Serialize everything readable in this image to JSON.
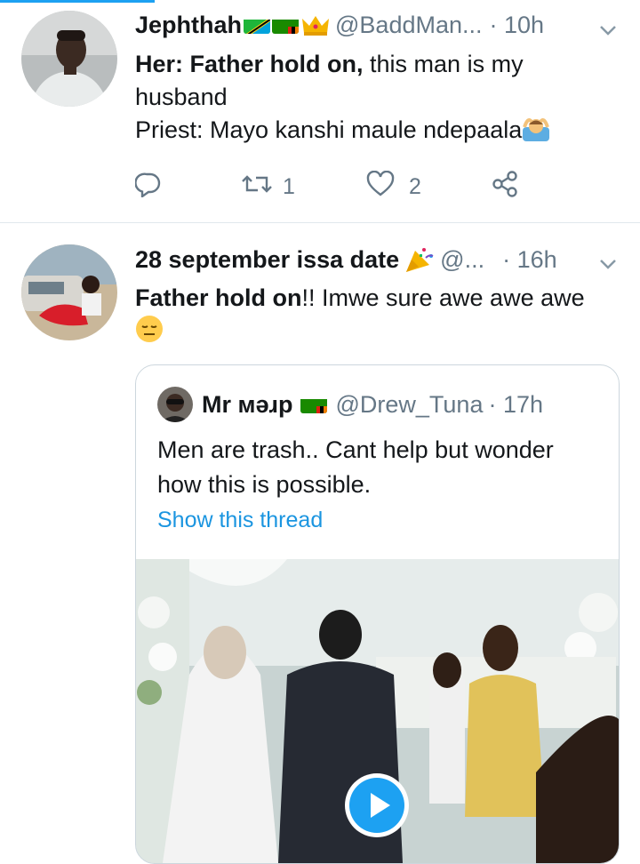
{
  "tweets": [
    {
      "name": "Jephthah",
      "handle": "@BaddMan...",
      "time": "· 10h",
      "line1_bold_label": "Her:",
      "line1_bold": "Father hold on,",
      "line1_rest": " this man is my husband",
      "line2": "Priest: Mayo kanshi maule ndepaala",
      "replies": "",
      "retweets": "1",
      "likes": "2"
    },
    {
      "name": "28 september issa date",
      "handle": "@...",
      "time": "· 16h",
      "text_bold": "Father hold on",
      "text_rest": "!! Imwe sure awe awe awe"
    }
  ],
  "quoted": {
    "name": "Mr мәɹp",
    "handle": "@Drew_Tuna",
    "time": "· 17h",
    "text": "Men are trash.. Cant help but wonder how this is possible.",
    "link": "Show this thread"
  },
  "icons": {
    "reply": "reply-icon",
    "retweet": "retweet-icon",
    "like": "heart-icon",
    "share": "share-icon",
    "more": "chevron-down-icon",
    "play": "play-icon"
  },
  "colors": {
    "accent": "#1da1f2",
    "link": "#1b95e0",
    "muted": "#657786",
    "border": "#e1e8ed"
  }
}
